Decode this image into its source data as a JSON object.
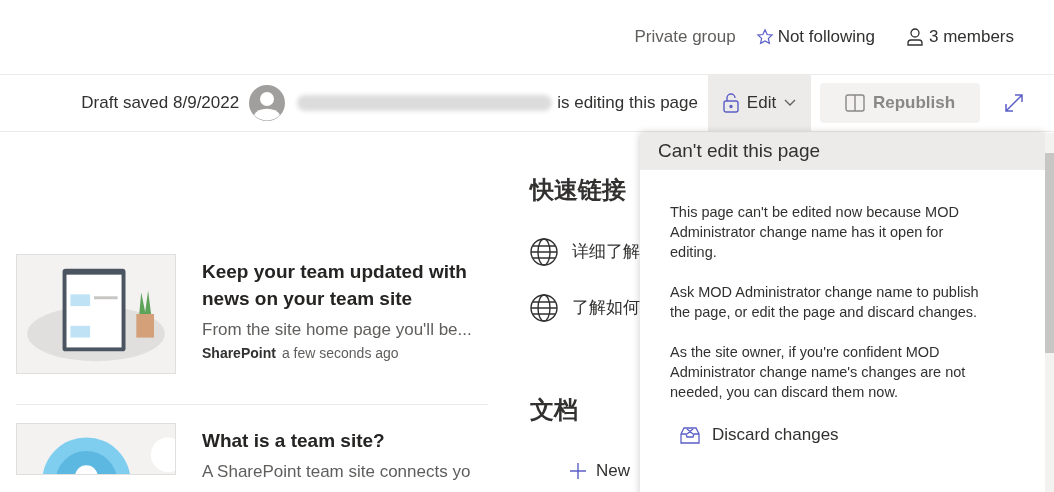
{
  "header": {
    "privacy": "Private group",
    "follow": {
      "label": "Not following",
      "following": false
    },
    "members": "3 members"
  },
  "command_bar": {
    "draft_status": "Draft saved 8/9/2022",
    "editing_status": "is editing this page",
    "edit_button": "Edit",
    "republish": {
      "label": "Republish",
      "disabled": true
    }
  },
  "news": [
    {
      "title": "Keep your team updated with news on your team site",
      "description": "From the site home page you'll be...",
      "source": "SharePoint",
      "time": "a few seconds ago"
    },
    {
      "title": "What is a team site?",
      "description": "A SharePoint team site connects yo"
    }
  ],
  "quick_links": {
    "title": "快速链接",
    "links": [
      "详细了解",
      "了解如何"
    ]
  },
  "documents": {
    "title": "文档",
    "new_button": "New"
  },
  "panel": {
    "title": "Can't edit this page",
    "paragraphs": [
      "This page can't be edited now because MOD Administrator change name has it open for editing.",
      "Ask MOD Administrator change name to publish the page, or edit the page and discard changes.",
      "As the site owner, if you're confident MOD Administrator change name's changes are not needed, you can discard them now."
    ],
    "action": "Discard changes"
  }
}
